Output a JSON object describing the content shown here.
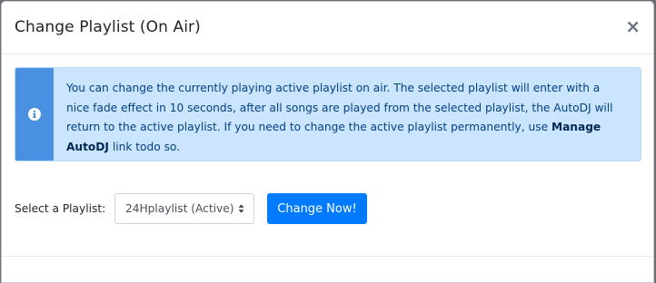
{
  "modal": {
    "title": "Change Playlist (On Air)",
    "close_label": "×"
  },
  "alert": {
    "icon": "info-circle-icon",
    "text_before": "You can change the currently playing active playlist on air. The selected playlist will enter with a nice fade effect in 10 seconds, after all songs are played from the selected playlist, the AutoDJ will return to the active playlist. If you need to change the active playlist permanently, use ",
    "link_text": "Manage AutoDJ",
    "text_after": " link todo so."
  },
  "form": {
    "label": "Select a Playlist:",
    "select_value": "24Hplaylist (Active)",
    "button_label": "Change Now!"
  },
  "colors": {
    "primary": "#007bff",
    "alert_bg": "#cce5ff",
    "alert_icon_bar": "#4a90e2"
  }
}
